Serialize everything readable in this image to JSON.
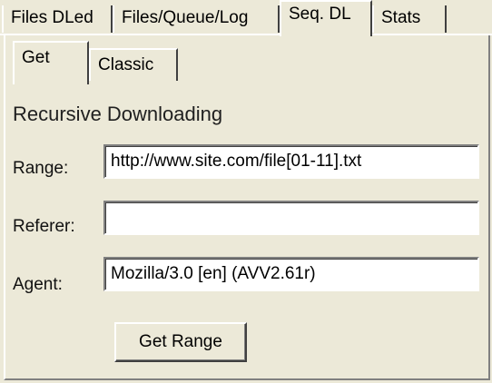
{
  "tabs": [
    "Files DLed",
    "Files/Queue/Log",
    "Seq. DL",
    "Stats"
  ],
  "active_tab": "Seq. DL",
  "subtabs": [
    "Get",
    "Classic"
  ],
  "active_subtab": "Get",
  "section": {
    "heading": "Recursive Downloading"
  },
  "form": {
    "range_label": "Range:",
    "range_value": "http://www.site.com/file[01-11].txt",
    "referer_label": "Referer:",
    "referer_value": "",
    "agent_label": "Agent:",
    "agent_value": "Mozilla/3.0 [en] (AVV2.61r)"
  },
  "buttons": {
    "get_range": "Get Range"
  },
  "colors": {
    "face": "#ece9d8",
    "field": "#ffffff",
    "highlight": "#ffffff",
    "shadow": "#808080"
  }
}
